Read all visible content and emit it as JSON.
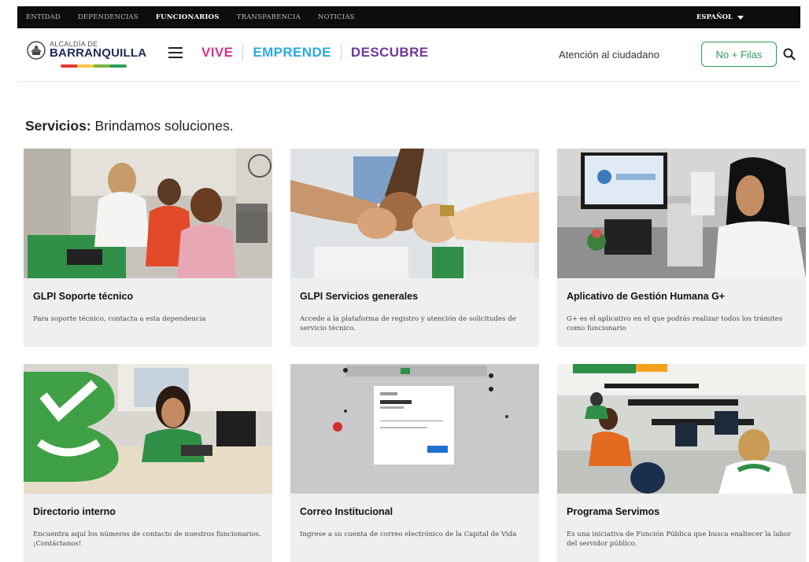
{
  "topnav": {
    "items": [
      "ENTIDAD",
      "DEPENDENCIAS",
      "FUNCIONARIOS",
      "TRANSPARENCIA",
      "NOTICIAS"
    ],
    "active": "FUNCIONARIOS",
    "language": "ESPAÑOL"
  },
  "header": {
    "logo_small": "ALCALDÍA DE",
    "logo_big": "BARRANQUILLA",
    "logo_stripe_colors": [
      "#e53935",
      "#f7c948",
      "#7cb342",
      "#2e9b55"
    ],
    "nav": [
      {
        "label": "VIVE",
        "color": "#d6338a"
      },
      {
        "label": "EMPRENDE",
        "color": "#29a9e0"
      },
      {
        "label": "DESCUBRE",
        "color": "#6f3a9a"
      }
    ],
    "atencion": "Atención al ciudadano",
    "filas_button": "No + Filas",
    "filas_color": "#2e9b55",
    "search_icon": "search-icon",
    "menu_icon": "hamburger-menu-icon"
  },
  "section": {
    "title_bold": "Servicios:",
    "title_rest": " Brindamos soluciones."
  },
  "cards": [
    {
      "title": "GLPI Soporte técnico",
      "desc": "Para soporte técnico, contacta a esta dependencia"
    },
    {
      "title": "GLPI Servicios generales",
      "desc": "Accede a la plataforma de registro y atención de solicitudes de servicio técnico."
    },
    {
      "title": "Aplicativo de Gestión Humana G+",
      "desc": "G+ es el aplicativo en el que podrás realizar todos los trámites como funcionario"
    },
    {
      "title": "Directorio interno",
      "desc": "Encuentra aquí los números de contacto de nuestros funcionarios. ¡Contáctanos!"
    },
    {
      "title": "Correo Institucional",
      "desc": "Ingrese a su cuenta de correo electrónico de la Capital de Vida"
    },
    {
      "title": "Programa Servimos",
      "desc": "Es una iniciativa de Función Pública que busca enaltecer la labor del servidor público."
    }
  ]
}
